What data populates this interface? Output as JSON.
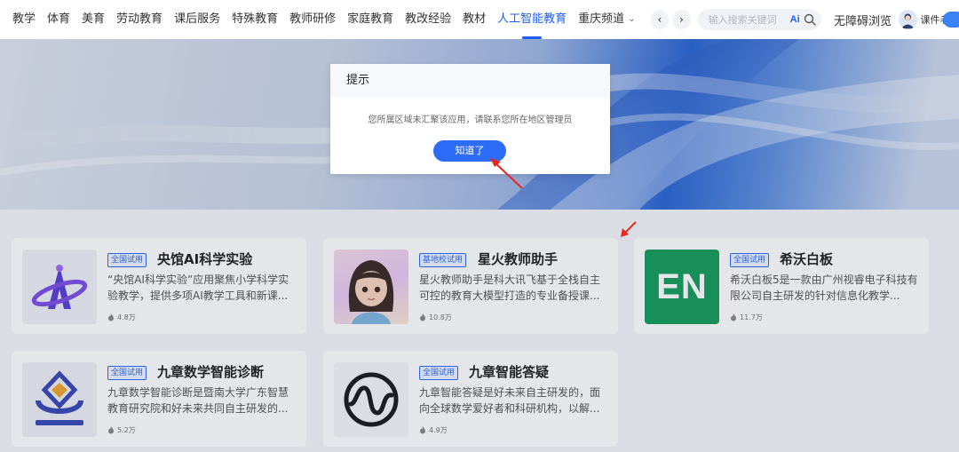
{
  "nav": {
    "items": [
      {
        "label": "教学",
        "active": false
      },
      {
        "label": "体育",
        "active": false
      },
      {
        "label": "美育",
        "active": false
      },
      {
        "label": "劳动教育",
        "active": false
      },
      {
        "label": "课后服务",
        "active": false
      },
      {
        "label": "特殊教育",
        "active": false
      },
      {
        "label": "教师研修",
        "active": false
      },
      {
        "label": "家庭教育",
        "active": false
      },
      {
        "label": "教改经验",
        "active": false
      },
      {
        "label": "教材",
        "active": false
      },
      {
        "label": "人工智能教育",
        "active": true
      }
    ],
    "more_label": "重庆频道",
    "prev_icon": "chevron-left-icon",
    "next_icon": "chevron-right-icon",
    "search_placeholder": "输入搜索关键词",
    "ai_icon_text": "Ai",
    "accessible_label": "无障碍浏览",
    "username": "课件老...",
    "accent_color": "#1e5ef5"
  },
  "cards": [
    {
      "tag": "全国试用",
      "title": "央馆AI科学实验",
      "desc": "“央馆AI科学实验”应用聚焦小学科学实验教学，提供多项AI教学工具和新课...",
      "stat": "4.8万",
      "logo": "ai-science-logo"
    },
    {
      "tag": "基地校试用",
      "title": "星火教师助手",
      "desc": "星火教师助手是科大讯飞基于全栈自主可控的教育大模型打造的专业备授课...",
      "stat": "10.8万",
      "logo": "cartoon-girl-avatar"
    },
    {
      "tag": "全国试用",
      "title": "希沃白板",
      "desc": "希沃白板5是一款由广州视睿电子科技有限公司自主研发的针对信息化教学...",
      "stat": "11.7万",
      "logo": "en-logo",
      "logo_text": "EN"
    },
    {
      "tag": "全国试用",
      "title": "九章数学智能诊断",
      "desc": "九章数学智能诊断是暨南大学广东智慧教育研究院和好未来共同自主研发的...",
      "stat": "5.2万",
      "logo": "jiuzhang-math-logo"
    },
    {
      "tag": "全国试用",
      "title": "九章智能答疑",
      "desc": "九章智能答疑是好未来自主研发的，面向全球数学爱好者和科研机构，以解...",
      "stat": "4.9万",
      "logo": "wave-circle-logo"
    }
  ],
  "modal": {
    "title": "提示",
    "message": "您所属区域未汇聚该应用，请联系您所在地区管理员",
    "button_label": "知道了",
    "button_color": "#2d6cf6"
  }
}
